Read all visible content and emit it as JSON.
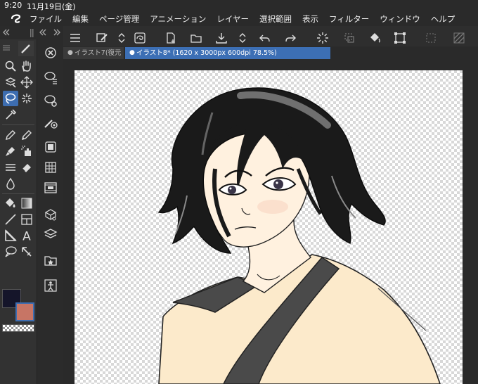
{
  "status": {
    "time": "9:20",
    "date": "11月19日(金)"
  },
  "menu": [
    "ファイル",
    "編集",
    "ページ管理",
    "アニメーション",
    "レイヤー",
    "選択範囲",
    "表示",
    "フィルター",
    "ウィンドウ",
    "ヘルプ"
  ],
  "tabs": [
    {
      "label": "イラスト7(復元",
      "active": false
    },
    {
      "label": "イラスト8* (1620 x 3000px 600dpi 78.5%)",
      "active": true
    }
  ],
  "colors": {
    "main": "#15152a",
    "sub": "#c77565",
    "accent": "#3d6db0"
  },
  "tools": [
    "zoom-icon",
    "hand-icon",
    "move-layer-icon",
    "move-icon",
    "lasso-icon",
    "auto-select-icon",
    "eyedropper-icon",
    "pen-icon",
    "pencil-icon",
    "brush-icon",
    "airbrush-icon",
    "decoration-icon",
    "eraser-icon",
    "blend-icon",
    "fill-icon",
    "gradient-icon",
    "figure-icon",
    "frame-icon",
    "ruler-icon",
    "text-icon",
    "balloon-icon",
    "line-correction-icon"
  ],
  "subtools": [
    "lasso-select-subtool",
    "selection-pen-subtool",
    "color-range-subtool",
    "rough-selection-subtool",
    "navigator-panel",
    "layer-property-panel",
    "animation-panel",
    "3d-material-panel",
    "layer-panel",
    "material-panel",
    "ref-panel"
  ]
}
